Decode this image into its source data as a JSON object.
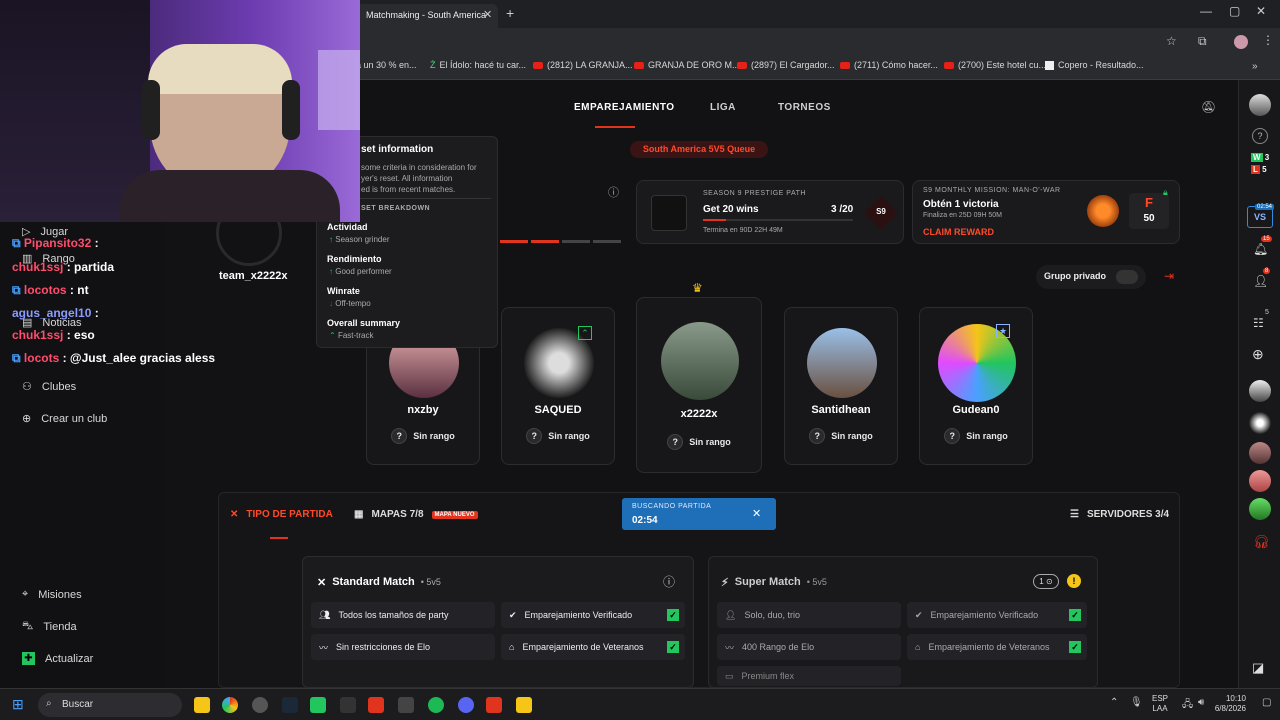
{
  "browser": {
    "tab_title": "Matchmaking - South America",
    "bookmarks": [
      "a un 30 % en...",
      "El Ídolo: hacé tu car...",
      "(2812) LA GRANJA...",
      "GRANJA DE ORO M...",
      "(2897) El Cargador...",
      "(2711) Cómo hacer...",
      "(2700) Este hotel cu...",
      "Copero - Resultado..."
    ]
  },
  "nav": {
    "tabs": [
      "EMPAREJAMIENTO",
      "LIGA",
      "TORNEOS"
    ]
  },
  "queue_badge": "South America 5V5 Queue",
  "reset_tooltip": {
    "title": "set information",
    "body": [
      "some criteria in consideration for",
      "yer's reset. All information",
      "ed is from recent matches."
    ],
    "breakdown_title": "SET BREAKDOWN",
    "items": [
      {
        "title": "Actividad",
        "value": "Season grinder"
      },
      {
        "title": "Rendimiento",
        "value": "Good performer"
      },
      {
        "title": "Winrate",
        "value": "Off-tempo"
      },
      {
        "title": "Overall summary",
        "value": "Fast-track"
      }
    ]
  },
  "profile": {
    "team_name": "team_x2222x"
  },
  "prestige": {
    "label": "SEASON 9 PRESTIGE PATH",
    "goal": "Get 20 wins",
    "progress": "3 /20",
    "progress_fraction": 0.15,
    "ends": "Termina en 90D 22H 49M",
    "badge": "S9"
  },
  "mission": {
    "label": "S9 MONTHLY MISSION: MAN-O'-WAR",
    "title": "Obtén 1 victoria",
    "ends": "Finaliza en 25D 09H 50M",
    "claim": "CLAIM REWARD",
    "grade": "F",
    "points": "50"
  },
  "private_group": "Grupo privado",
  "players": [
    {
      "name": "nxzby",
      "rank": "Sin rango"
    },
    {
      "name": "SAQUED",
      "rank": "Sin rango"
    },
    {
      "name": "x2222x",
      "rank": "Sin rango"
    },
    {
      "name": "Santidhean",
      "rank": "Sin rango"
    },
    {
      "name": "Gudean0",
      "rank": "Sin rango"
    }
  ],
  "match_bar": {
    "type_label": "TIPO DE PARTIDA",
    "maps_label": "MAPAS 7/8",
    "maps_badge": "MAPA NUEVO",
    "searching_label": "BUSCANDO PARTIDA",
    "timer": "02:54",
    "servers_label": "SERVIDORES 3/4"
  },
  "standard_match": {
    "title": "Standard Match",
    "mode": "• 5v5",
    "options": [
      "Todos los tamaños de party",
      "Emparejamiento Verificado",
      "Sin restricciones de Elo",
      "Emparejamiento de Veteranos"
    ]
  },
  "super_match": {
    "title": "Super Match",
    "mode": "• 5v5",
    "counter": "1",
    "options": [
      "Solo, duo, trio",
      "Emparejamiento Verificado",
      "400 Rango de Elo",
      "Emparejamiento de Veteranos",
      "Premium flex"
    ]
  },
  "sidebar": {
    "items": [
      "Jugar",
      "Rango",
      "Noticias",
      "Clubes",
      "Crear un club"
    ],
    "bottom": [
      "Misiones",
      "Tienda",
      "Actualizar"
    ]
  },
  "chat": [
    {
      "user": "Pipansito32",
      "msg": " :",
      "color": "#ff4d6d"
    },
    {
      "user": "chuk1ssj",
      "msg": " : partida",
      "color": "#ff4d6d"
    },
    {
      "user": "locotos",
      "msg": " : nt",
      "color": "#ff4d6d"
    },
    {
      "user": "agus_angel10",
      "msg": " :",
      "color": "#6c8cff"
    },
    {
      "user": "chuk1ssj",
      "msg": " : eso",
      "color": "#ff4d6d"
    },
    {
      "user": "locots",
      "msg": " : @Just_alee gracias aless",
      "color": "#ff4d6d"
    }
  ],
  "rightbar": {
    "w": "3",
    "l": "5",
    "vs_timer": "02:54",
    "notif": "15",
    "friends": "8",
    "count5": "5"
  },
  "taskbar": {
    "search": "Buscar",
    "lang1": "ESP",
    "lang2": "LAA",
    "time": "10:10",
    "date": "6/8/2026"
  }
}
